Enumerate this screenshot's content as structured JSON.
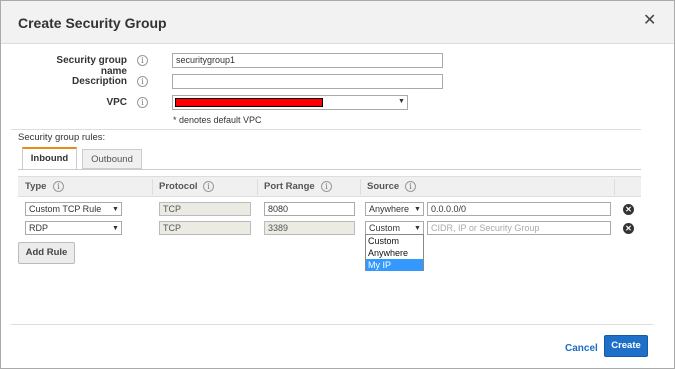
{
  "dialog": {
    "title": "Create Security Group",
    "close_glyph": "✕"
  },
  "form": {
    "name_label": "Security group name",
    "name_value": "securitygroup1",
    "description_label": "Description",
    "description_value": "",
    "vpc_label": "VPC",
    "vpc_value_redacted": true,
    "vpc_note": "* denotes default VPC",
    "info_glyph": "i"
  },
  "rules": {
    "section_label": "Security group rules:",
    "tabs": [
      "Inbound",
      "Outbound"
    ],
    "active_tab": "Inbound",
    "columns": [
      "Type",
      "Protocol",
      "Port Range",
      "Source"
    ],
    "rows": [
      {
        "type": "Custom TCP Rule",
        "protocol": "TCP",
        "port_range": "8080",
        "source": "Anywhere",
        "cidr": "0.0.0.0/0",
        "cidr_placeholder": ""
      },
      {
        "type": "RDP",
        "protocol": "TCP",
        "port_range": "3389",
        "source": "Custom",
        "cidr": "",
        "cidr_placeholder": "CIDR, IP or Security Group"
      }
    ],
    "source_dropdown_options": [
      "Custom",
      "Anywhere",
      "My IP"
    ],
    "source_dropdown_highlighted": "My IP",
    "add_rule_label": "Add Rule",
    "select_arrow": "▼",
    "remove_glyph": "✕"
  },
  "footer": {
    "cancel_label": "Cancel",
    "create_label": "Create"
  },
  "colors": {
    "primary_button": "#1d6fc8",
    "link": "#1a6fc4",
    "active_tab_accent": "#e88c1b",
    "redaction": "#ff0000",
    "dropdown_highlight": "#3399ff"
  }
}
